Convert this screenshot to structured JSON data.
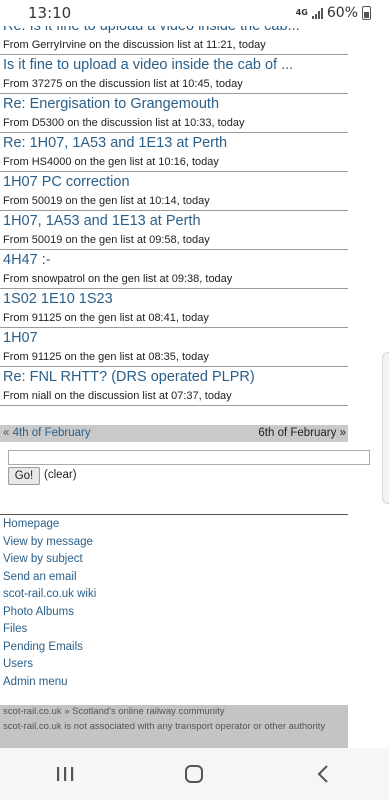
{
  "status_bar": {
    "time": "13:10",
    "network": "4G",
    "battery": "60%"
  },
  "messages": [
    {
      "title": "Re: Is it fine to upload a video inside the cab...",
      "meta": "From GerryIrvine on the discussion list at 11:21, today"
    },
    {
      "title": "Is it fine to upload a video inside the cab of ...",
      "meta": "From 37275 on the discussion list at 10:45, today"
    },
    {
      "title": "Re: Energisation to Grangemouth",
      "meta": "From D5300 on the discussion list at 10:33, today"
    },
    {
      "title": "Re: 1H07, 1A53 and 1E13 at Perth",
      "meta": "From HS4000 on the gen list at 10:16, today"
    },
    {
      "title": "1H07 PC correction",
      "meta": "From 50019 on the gen list at 10:14, today"
    },
    {
      "title": "1H07, 1A53 and 1E13 at Perth",
      "meta": "From 50019 on the gen list at 09:58, today"
    },
    {
      "title": "4H47 :-",
      "meta": "From snowpatrol on the gen list at 09:38, today"
    },
    {
      "title": "1S02 1E10 1S23",
      "meta": "From 91125 on the gen list at 08:41, today"
    },
    {
      "title": "1H07",
      "meta": "From 91125 on the gen list at 08:35, today"
    },
    {
      "title": "Re: FNL RHTT? (DRS operated PLPR)",
      "meta": "From niall on the discussion list at 07:37, today"
    }
  ],
  "date_nav": {
    "prev_arrow": "«",
    "prev_label": "4th of February",
    "next_label": "6th of February",
    "next_arrow": "»"
  },
  "search": {
    "value": "",
    "go_label": "Go!",
    "clear_label": "(clear)"
  },
  "nav_links": [
    "Homepage",
    "View by message",
    "View by subject",
    "Send an email",
    "scot-rail.co.uk wiki",
    "Photo Albums",
    "Files",
    "Pending Emails",
    "Users",
    "Admin menu"
  ],
  "footer": {
    "line1": "scot-rail.co.uk » Scotland's online railway community",
    "line2": "scot-rail.co.uk is not associated with any transport operator or other authority"
  },
  "icons": {
    "recents": "recents-icon",
    "home": "home-icon",
    "back": "back-icon"
  }
}
